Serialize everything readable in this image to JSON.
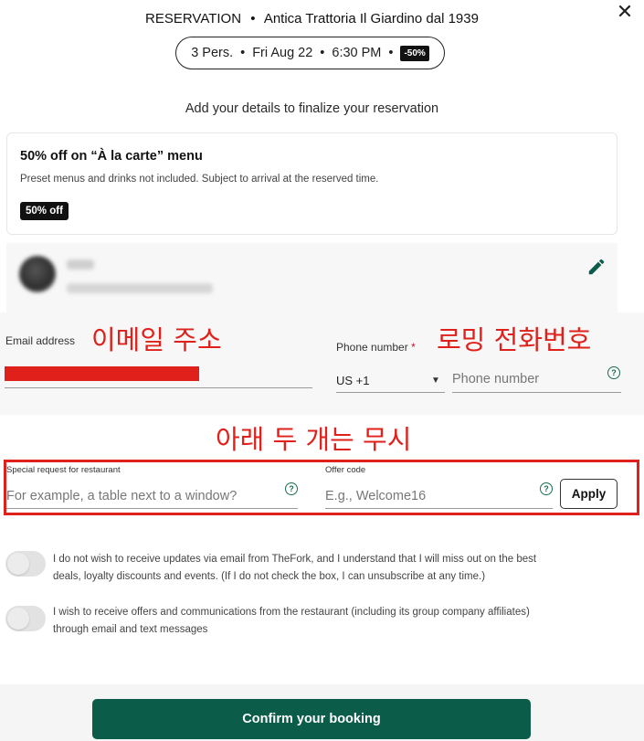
{
  "header": {
    "title_prefix": "RESERVATION",
    "title_separator": "•",
    "restaurant_name": "Antica Trattoria Il Giardino dal 1939",
    "close_icon": "close-icon"
  },
  "booking_summary": {
    "guests": "3 Pers.",
    "date": "Fri Aug 22",
    "time": "6:30 PM",
    "separator": "•",
    "discount_badge": "-50%"
  },
  "subtitle": "Add your details to finalize your reservation",
  "offer": {
    "title": "50% off on “À la carte” menu",
    "description": "Preset menus and drinks not included. Subject to arrival at the reserved time.",
    "badge": "50% off"
  },
  "profile": {
    "edit_icon": "pencil-icon"
  },
  "contact": {
    "email_label": "Email address",
    "email_annotation": "이메일 주소",
    "phone_label": "Phone number",
    "phone_required_mark": "*",
    "phone_annotation": "로밍 전화번호",
    "country_code": "US +1",
    "phone_placeholder": "Phone number"
  },
  "ignore_annotation": "아래 두 개는 무시",
  "extras": {
    "special_request_label": "Special request for restaurant",
    "special_request_placeholder": "For example, a table next to a window?",
    "offer_code_label": "Offer code",
    "offer_code_placeholder": "E.g., Welcome16",
    "apply_label": "Apply"
  },
  "consents": {
    "newsletter_opt_out_line1": "I do not wish to receive updates via email from TheFork, and I understand that I will miss out on the best",
    "newsletter_opt_out_line2": "deals, loyalty discounts and events. (If I do not check the box, I can unsubscribe at any time.)",
    "restaurant_offers_line1": "I wish to receive offers and communications from the restaurant (including its group company affiliates)",
    "restaurant_offers_line2": "through email and text messages"
  },
  "confirm_label": "Confirm your booking",
  "colors": {
    "brand_green": "#0c5c4a",
    "annotation_red": "#e0201a"
  }
}
